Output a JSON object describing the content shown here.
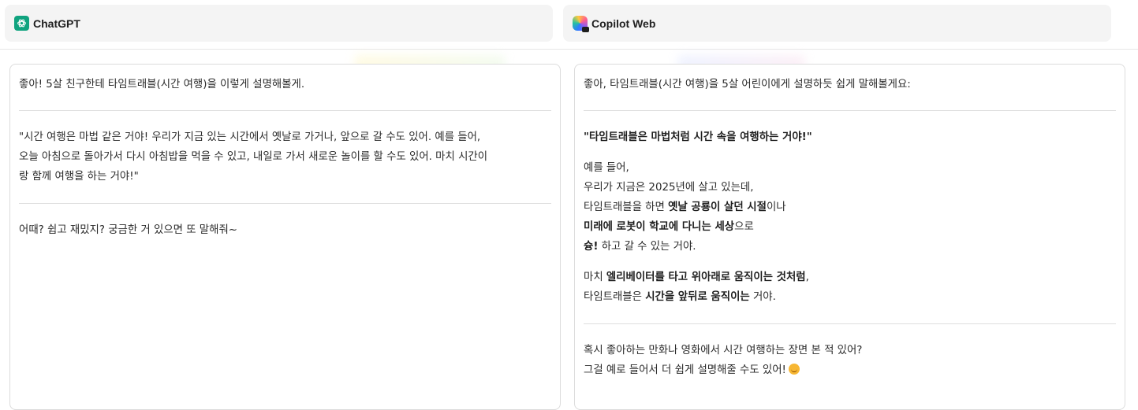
{
  "tabs": [
    {
      "title": "ChatGPT",
      "icon": "chatgpt-icon",
      "color": "#10a37f"
    },
    {
      "title": "Copilot Web",
      "icon": "copilot-icon"
    }
  ],
  "chatgpt": {
    "intro": "좋아! 5살 친구한테 타임트래블(시간 여행)을 이렇게 설명해볼게.",
    "quote_line1": "\"시간 여행은 마법 같은 거야! 우리가 지금 있는 시간에서 옛날로 가거나, 앞으로 갈 수도 있어. 예를 들어,",
    "quote_line2": "오늘 아침으로 돌아가서 다시 아침밥을 먹을 수 있고, 내일로 가서 새로운 놀이를 할 수도 있어. 마치 시간이",
    "quote_line3": "랑 함께 여행을 하는 거야!\"",
    "outro": "어때? 쉽고 재밌지? 궁금한 거 있으면 또 말해줘~"
  },
  "copilot": {
    "intro": "좋아, 타임트래블(시간 여행)을 5살 어린이에게 설명하듯 쉽게 말해볼게요:",
    "headline": "\"타임트래블은 마법처럼 시간 속을 여행하는 거야!\"",
    "ex1": "예를 들어,",
    "ex2": "우리가 지금은 2025년에 살고 있는데,",
    "ex3_pre": "타임트래블을 하면 ",
    "ex3_bold": "옛날 공룡이 살던 시절",
    "ex3_post": "이나",
    "ex4_bold": "미래에 로봇이 학교에 다니는 세상",
    "ex4_post": "으로",
    "ex5_bold": "슝!",
    "ex5_post": " 하고 갈 수 있는 거야.",
    "m1_pre": "마치 ",
    "m1_bold": "엘리베이터를 타고 위아래로 움직이는 것처럼",
    "m1_post": ",",
    "m2_pre": "타임트래블은 ",
    "m2_bold": "시간을 앞뒤로 움직이는",
    "m2_post": " 거야.",
    "q1": "혹시 좋아하는 만화나 영화에서 시간 여행하는 장면 본 적 있어?",
    "q2": "그걸 예로 들어서 더 쉽게 설명해줄 수도 있어!"
  }
}
